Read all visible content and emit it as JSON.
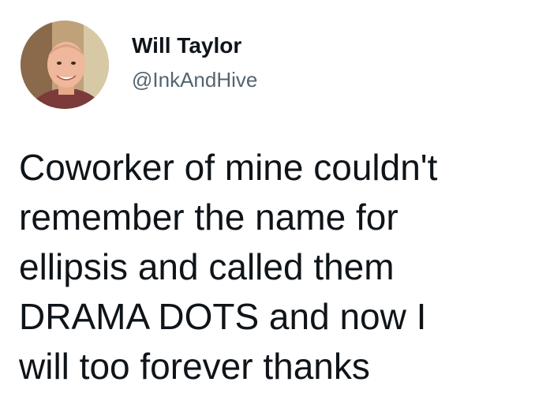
{
  "author": {
    "display_name": "Will Taylor",
    "handle": "@InkAndHive"
  },
  "tweet": {
    "lines": [
      "Coworker of mine couldn't",
      "remember the name for",
      "ellipsis and called them",
      "DRAMA DOTS and now I",
      "will too forever thanks"
    ]
  },
  "colors": {
    "text": "#0f1419",
    "handle": "#536471",
    "background": "#ffffff"
  }
}
